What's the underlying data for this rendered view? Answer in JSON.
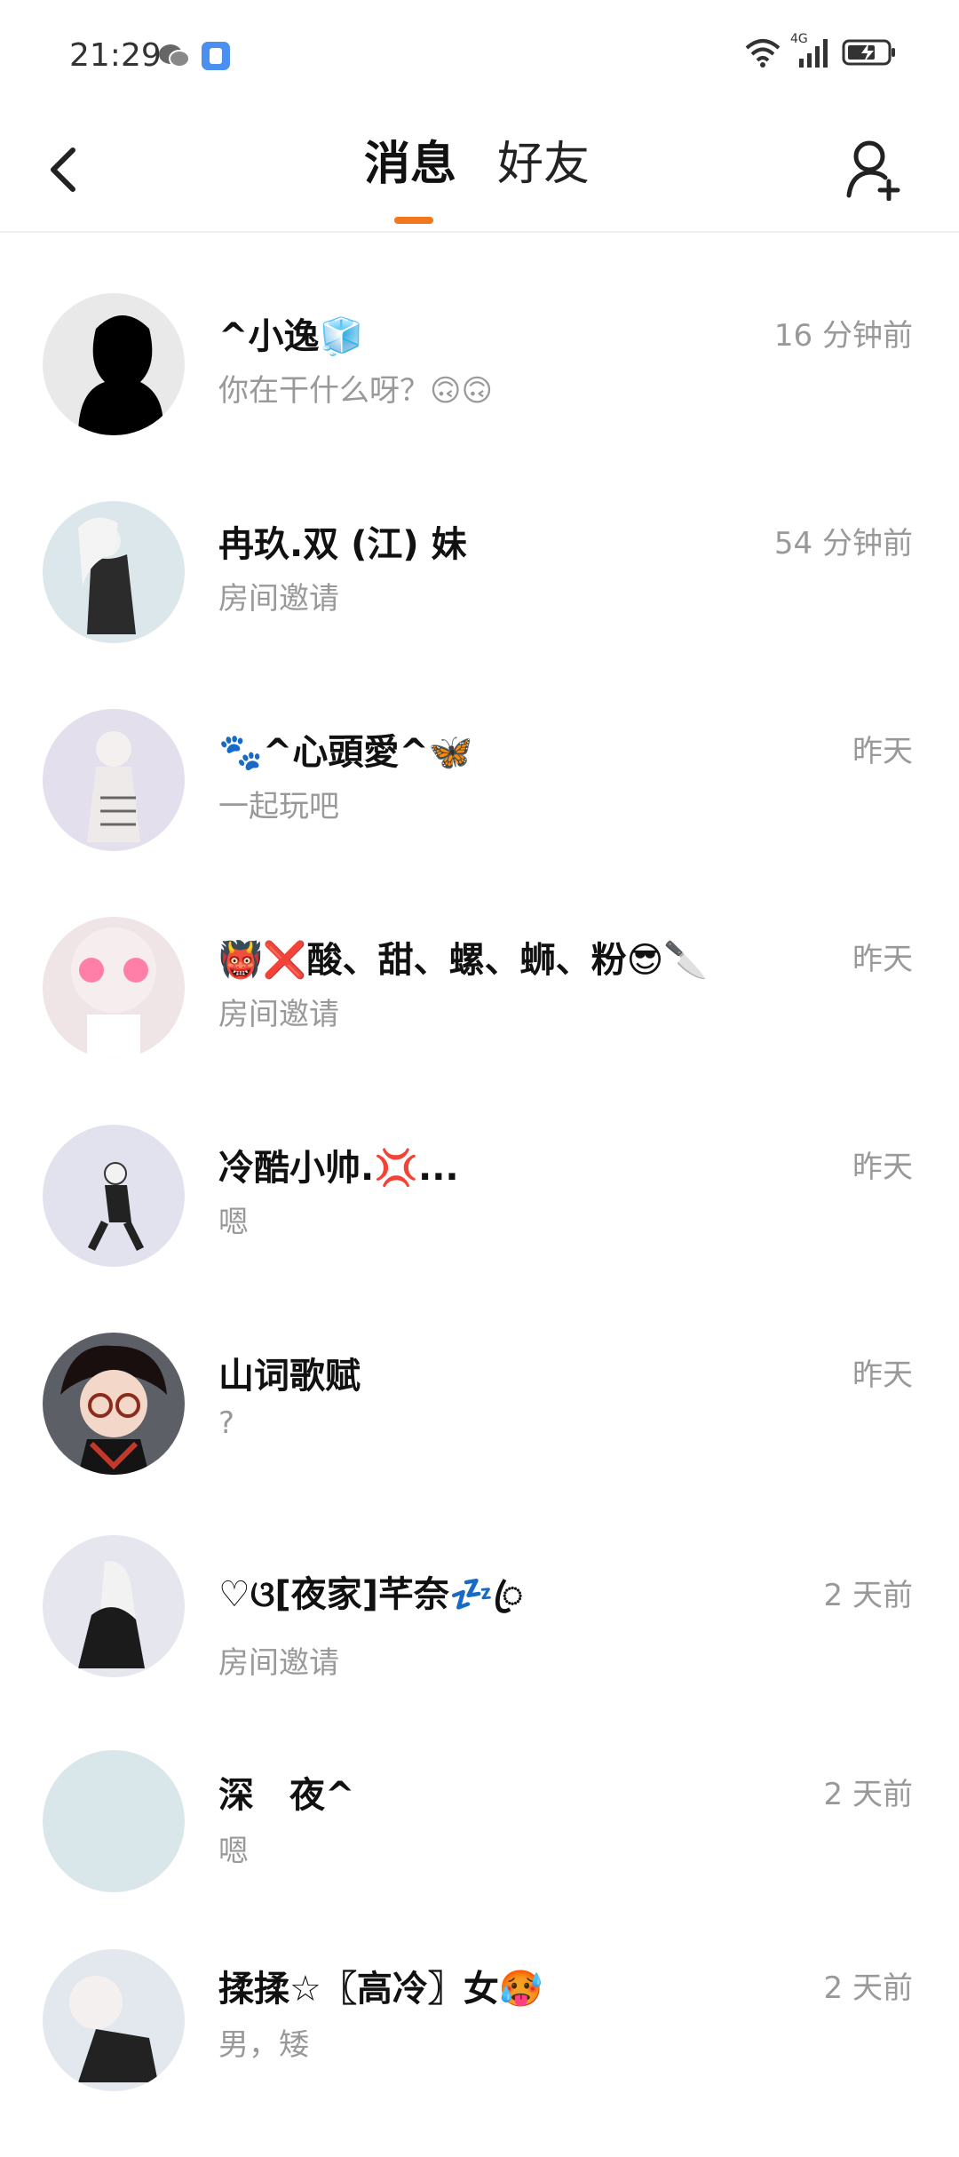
{
  "status_bar": {
    "time": "21:29",
    "network": "4G"
  },
  "header": {
    "tabs": [
      {
        "label": "消息",
        "active": true
      },
      {
        "label": "好友",
        "active": false
      }
    ],
    "accent_color": "#f0771e"
  },
  "messages": [
    {
      "name": "^小逸🧊",
      "preview": "你在干什么呀？🙃🙃",
      "time": "16 分钟前"
    },
    {
      "name": "冉玖.双 (江) 妹",
      "preview": "房间邀请",
      "time": "54 分钟前"
    },
    {
      "name": "🐾^心頭愛^🦋",
      "preview": "一起玩吧",
      "time": "昨天"
    },
    {
      "name": "👹❌酸、甜、螺、蛳、粉😎🔪",
      "preview": "房间邀请",
      "time": "昨天"
    },
    {
      "name": "冷酷小帅.💢...",
      "preview": "嗯",
      "time": "昨天"
    },
    {
      "name": "山词歌赋",
      "preview": "?",
      "time": "昨天"
    },
    {
      "name": "♡ଓ[夜家]芊奈💤ꦿ",
      "preview": "房间邀请",
      "time": "2 天前"
    },
    {
      "name": "深　夜^",
      "preview": "嗯",
      "time": "2 天前"
    },
    {
      "name": "揉揉☆〖高冷〗女🥵",
      "preview": "男，矮",
      "time": "2 天前"
    }
  ]
}
